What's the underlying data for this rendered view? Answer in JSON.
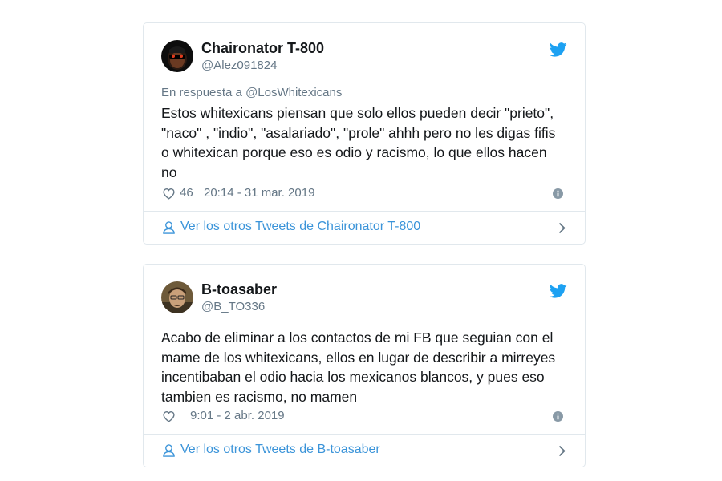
{
  "colors": {
    "text_primary": "#14171a",
    "text_secondary": "#657786",
    "link_blue": "#3b94d9",
    "twitter_blue": "#1da1f2",
    "border": "#e1e8ed"
  },
  "tweets": [
    {
      "display_name": "Chaironator T-800",
      "handle": "@Alez091824",
      "reply_context": "En respuesta a @LosWhitexicans",
      "text_lines": [
        "Estos whitexicans piensan que solo ellos pueden decir \"prieto\",",
        "\"naco\" , \"indio\", \"asalariado\", \"prole\" ahhh pero no les digas fifis",
        "o whitexican porque eso es odio y racismo, lo que ellos hacen",
        "no"
      ],
      "like_count": "46",
      "timestamp": "20:14 - 31 mar. 2019",
      "footer_link": "Ver los otros Tweets de Chaironator T-800",
      "icons": [
        "twitter-bird-icon",
        "heart-icon",
        "info-icon",
        "person-icon",
        "chevron-right-icon"
      ]
    },
    {
      "display_name": "B-toasaber",
      "handle": "@B_TO336",
      "text_lines": [
        "Acabo de eliminar a los contactos de mi FB que seguian con el",
        "mame de los whitexicans, ellos en lugar de describir a mirreyes",
        "incentibaban el odio hacia los mexicanos blancos, y pues eso",
        "tambien es racismo, no mamen"
      ],
      "like_count": "",
      "timestamp": "9:01 - 2 abr. 2019",
      "footer_link": "Ver los otros Tweets de B-toasaber",
      "icons": [
        "twitter-bird-icon",
        "heart-icon",
        "info-icon",
        "person-icon",
        "chevron-right-icon"
      ]
    }
  ]
}
